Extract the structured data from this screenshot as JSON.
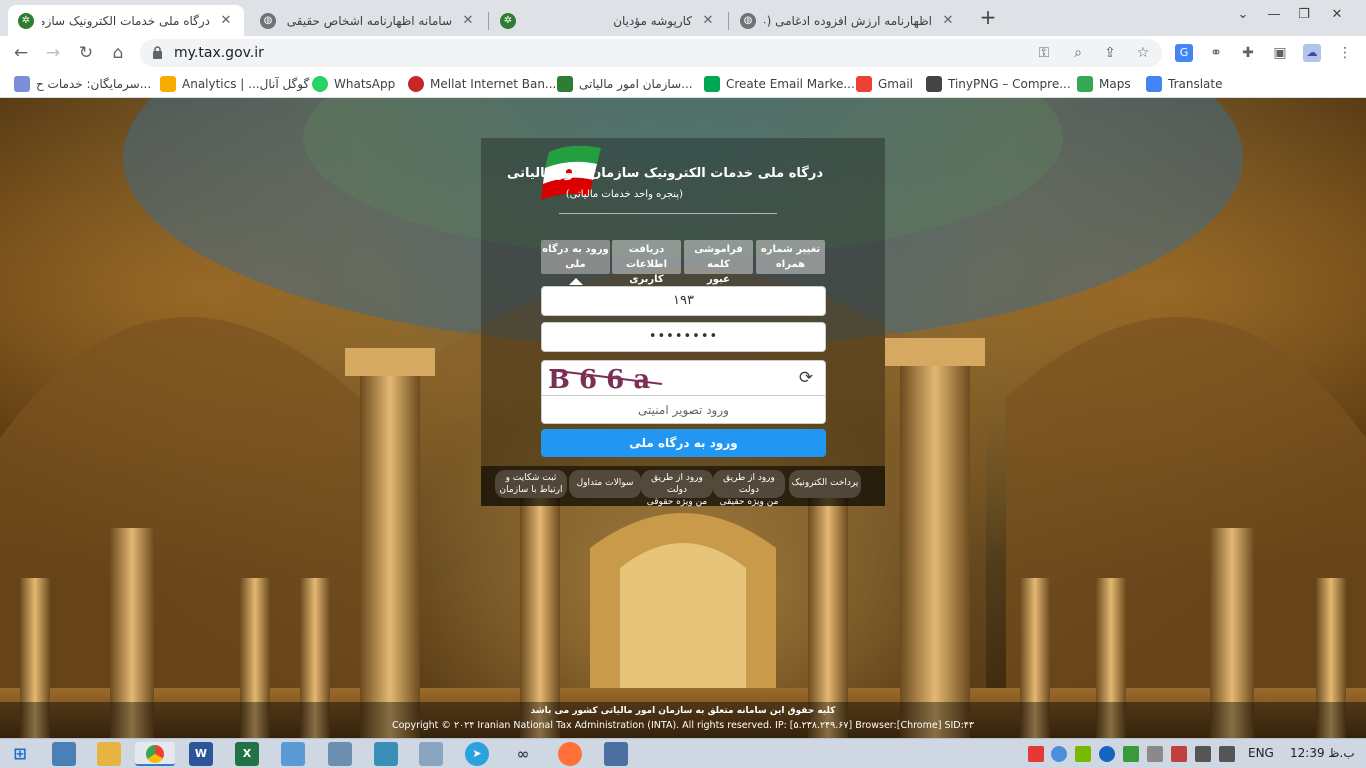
{
  "browser": {
    "tabs": [
      {
        "title": "درگاه ملی خدمات الکترونیک سازمان",
        "active": true
      },
      {
        "title": "سامانه اظهارنامه اشخاص حقیقی",
        "active": false
      },
      {
        "title": "کارپوشه مؤدیان",
        "active": false
      },
      {
        "title": "اظهارنامه ارزش افزوده ادغامی (عمو",
        "active": false
      }
    ],
    "url": "my.tax.gov.ir",
    "window_controls": {
      "chevron": "⌄",
      "minimize": "—",
      "restore": "❐",
      "close": "✕"
    },
    "new_tab": "+"
  },
  "bookmarks": [
    {
      "label": "سرمایگان: خدمات ح...",
      "icon": "cloud-icon",
      "color": "#7b8fd6"
    },
    {
      "label": "Analytics | ...گوگل آنال",
      "icon": "analytics-icon",
      "color": "#f9ab00"
    },
    {
      "label": "WhatsApp",
      "icon": "whatsapp-icon",
      "color": "#25d366"
    },
    {
      "label": "Mellat Internet Ban...",
      "icon": "mellat-icon",
      "color": "#c62828"
    },
    {
      "label": "سازمان امور مالیاتی...",
      "icon": "tax-icon",
      "color": "#2e7d32"
    },
    {
      "label": "Create Email Marke...",
      "icon": "email-icon",
      "color": "#00a651"
    },
    {
      "label": "Gmail",
      "icon": "gmail-icon",
      "color": "#ea4335"
    },
    {
      "label": "TinyPNG – Compre...",
      "icon": "panda-icon",
      "color": "#444444"
    },
    {
      "label": "Maps",
      "icon": "maps-icon",
      "color": "#34a853"
    },
    {
      "label": "Translate",
      "icon": "translate-icon",
      "color": "#4285f4"
    }
  ],
  "portal": {
    "title": "درگاه ملی خدمات الکترونیک سازمان امور مالیاتی",
    "subtitle": "(پنجره واحد خدمات مالیاتی)",
    "tabs": [
      {
        "line1": "تغییر شماره",
        "line2": "همراه"
      },
      {
        "line1": "فراموشی کلمه",
        "line2": "عبور"
      },
      {
        "line1": "دریافت اطلاعات",
        "line2": "کاربری"
      },
      {
        "line1": "ورود به درگاه",
        "line2": "ملی",
        "selected": true
      }
    ],
    "username_value": "۱۹۳",
    "password_value": "••••••••",
    "captcha_text": "B 6 6 a",
    "captcha_refresh": "⟳",
    "captcha_placeholder": "ورود تصویر امنیتی",
    "submit_label": "ورود به درگاه ملی",
    "links": [
      {
        "line1": "پرداخت الکترونیک",
        "line2": ""
      },
      {
        "line1": "ورود از طریق دولت",
        "line2": "من ویژه حقیقی"
      },
      {
        "line1": "ورود از طریق دولت",
        "line2": "من ویژه حقوقی"
      },
      {
        "line1": "سوالات متداول",
        "line2": ""
      },
      {
        "line1": "ثبت شکایت و",
        "line2": "ارتباط با سازمان"
      }
    ]
  },
  "footer": {
    "fa": "کلیه حقوق این سامانه متعلق به سازمان امور مالیاتی کشور می باشد",
    "en": "Copyright © ۲۰۲۴ Iranian National Tax Administration (INTA). All rights reserved. IP: [۵.۲۳۸.۲۴۹.۶۷] Browser:[Chrome] SID:۴۳"
  },
  "taskbar": {
    "lang": "ENG",
    "clock": "12:39 ب.ظ"
  }
}
